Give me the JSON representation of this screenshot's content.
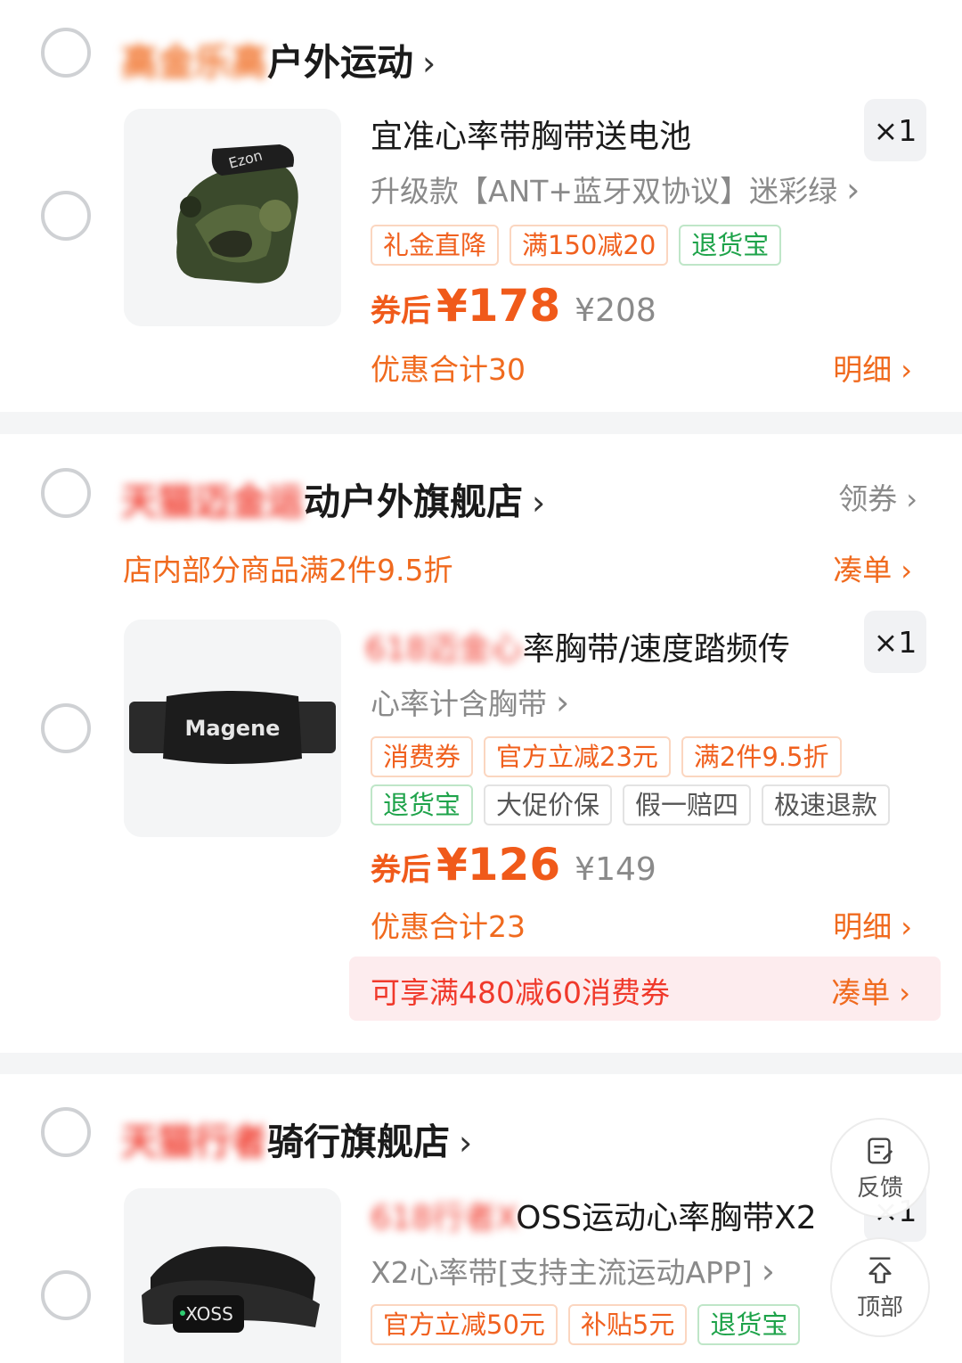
{
  "shops": [
    {
      "name_blurred": "高金乐高",
      "name_visible": "户外运动",
      "products": [
        {
          "title": "宜准心率带胸带送电池",
          "spec": "升级款【ANT+蓝牙双协议】迷彩绿",
          "qty": "×1",
          "tags": [
            "礼金直降",
            "满150减20",
            "退货宝"
          ],
          "price_label": "券后",
          "price": "¥178",
          "orig_price": "¥208",
          "saving": "优惠合计30",
          "detail": "明细"
        }
      ]
    },
    {
      "name_blurred": "天猫迈金运",
      "name_visible": "动户外旗舰店",
      "coupon": "领券",
      "promo": "店内部分商品满2件9.5折",
      "promo_link": "凑单",
      "products": [
        {
          "title_blurred": "618迈金心",
          "title": "率胸带/速度踏频传",
          "spec": "心率计含胸带",
          "qty": "×1",
          "tags_row1": [
            "消费券",
            "官方立减23元",
            "满2件9.5折"
          ],
          "tags_row2": [
            "退货宝",
            "大促价保",
            "假一赔四",
            "极速退款"
          ],
          "price_label": "券后",
          "price": "¥126",
          "orig_price": "¥149",
          "saving": "优惠合计23",
          "detail": "明细",
          "coupon_bar": "可享满480减60消费券",
          "coupon_bar_link": "凑单"
        }
      ]
    },
    {
      "name_blurred": "天猫行者",
      "name_visible": "骑行旗舰店",
      "products": [
        {
          "title_blurred": "618行者X",
          "title": "OSS运动心率胸带X2",
          "spec": "X2心率带[支持主流运动APP]",
          "qty": "×1",
          "tags": [
            "官方立减50元",
            "补贴5元",
            "退货宝"
          ]
        }
      ]
    }
  ],
  "float": {
    "feedback": "反馈",
    "top": "顶部"
  },
  "icons": {
    "chevron": "›"
  },
  "colors": {
    "accent_orange": "#f06a1e",
    "accent_red": "#f0392b",
    "tag_green": "#1ea34a"
  }
}
